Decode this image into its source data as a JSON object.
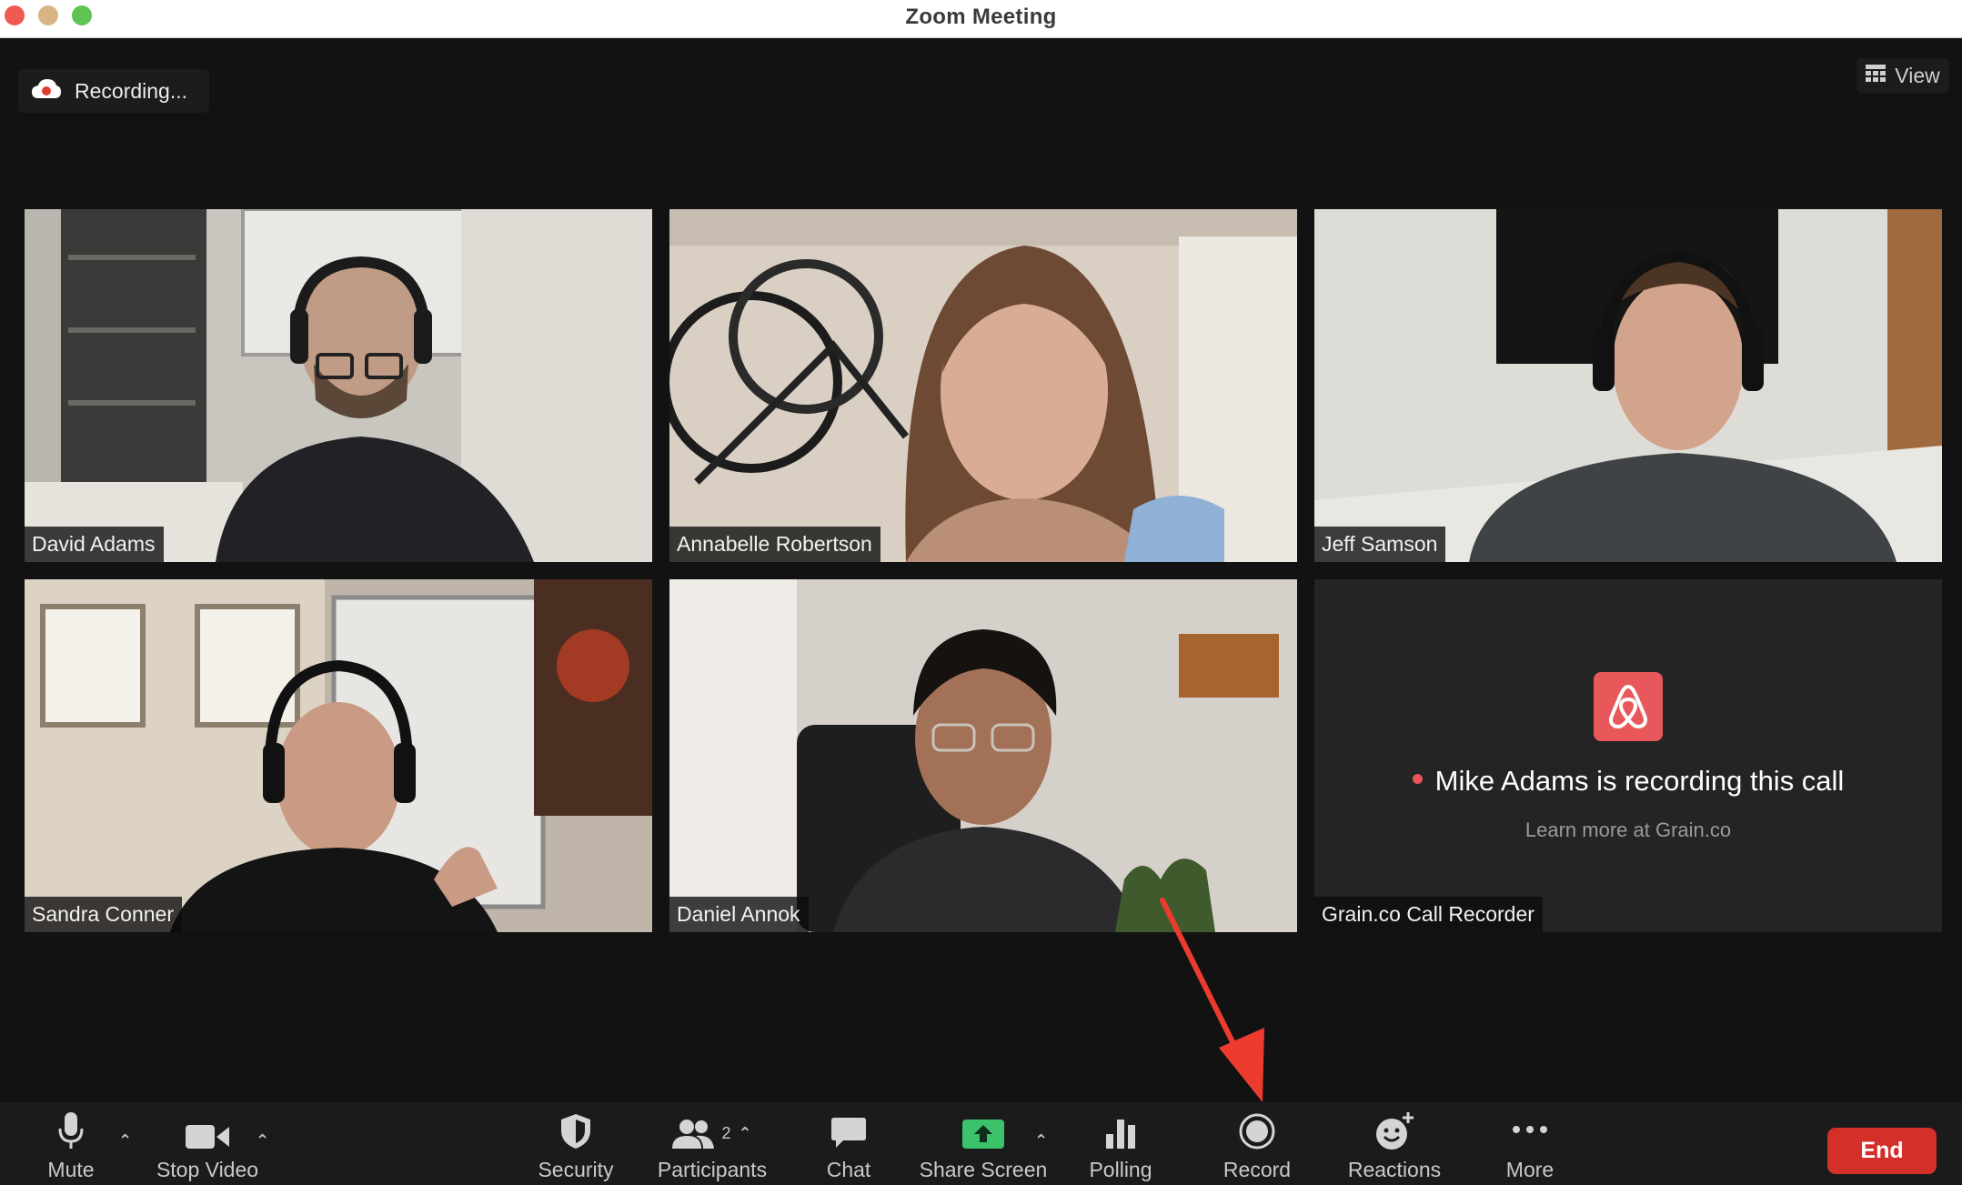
{
  "window": {
    "title": "Zoom Meeting"
  },
  "recording_indicator": {
    "label": "Recording..."
  },
  "view_button": {
    "label": "View"
  },
  "participants": [
    {
      "name": "David Adams"
    },
    {
      "name": "Annabelle Robertson"
    },
    {
      "name": "Jeff Samson"
    },
    {
      "name": "Sandra Conner"
    },
    {
      "name": "Daniel Annok"
    },
    {
      "name": "Grain.co Call Recorder"
    }
  ],
  "recorder_tile": {
    "message": "Mike Adams is recording this call",
    "link": "Learn more at Grain.co"
  },
  "toolbar": {
    "mute": "Mute",
    "stop_video": "Stop Video",
    "security": "Security",
    "participants": "Participants",
    "participant_count": "2",
    "chat": "Chat",
    "share_screen": "Share Screen",
    "polling": "Polling",
    "record": "Record",
    "reactions": "Reactions",
    "more": "More",
    "end": "End"
  },
  "colors": {
    "end_button": "#d3302a",
    "share_screen_green": "#3bc26b",
    "grain_brand": "#e8575a",
    "annotation_arrow": "#ee3b2f"
  },
  "icons": [
    "microphone-icon",
    "video-camera-icon",
    "shield-icon",
    "participants-icon",
    "chat-bubble-icon",
    "share-screen-icon",
    "polling-bars-icon",
    "record-icon",
    "reactions-icon",
    "more-dots-icon",
    "grid-view-icon",
    "cloud-recording-icon"
  ]
}
